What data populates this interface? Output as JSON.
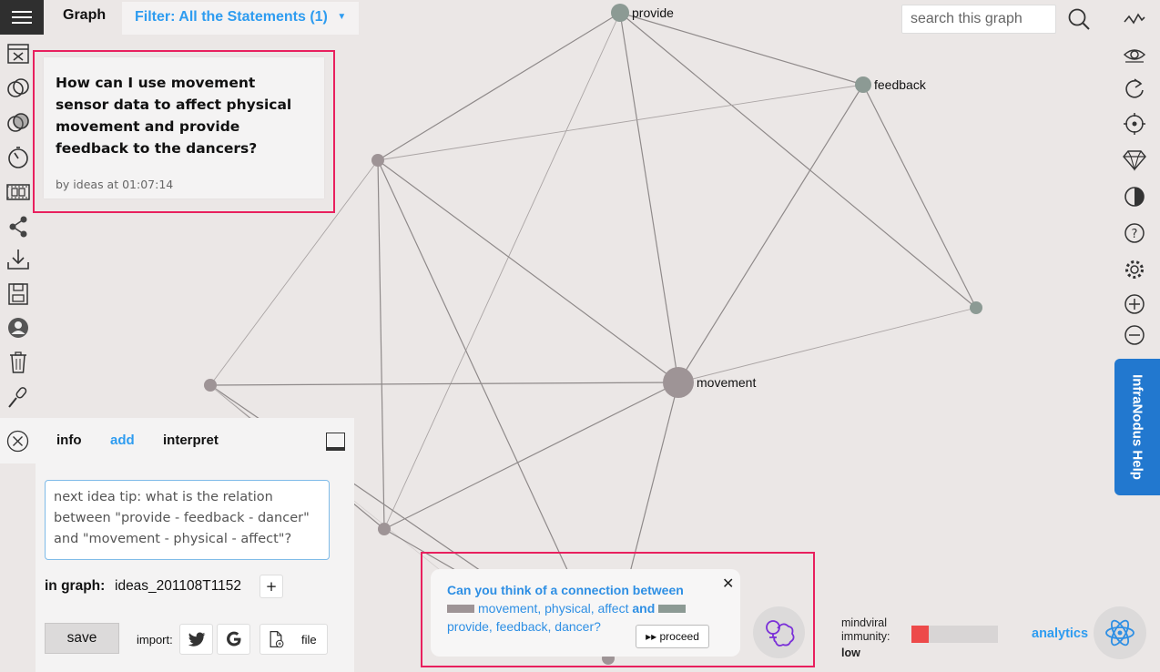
{
  "header": {
    "app_title": "Graph",
    "filter_label": "Filter: All the Statements (1)",
    "search_placeholder": "search this graph"
  },
  "graph": {
    "nodes": [
      {
        "id": "provide",
        "label": "provide",
        "color": "#8c9a94"
      },
      {
        "id": "feedback",
        "label": "feedback",
        "color": "#8c9a94"
      },
      {
        "id": "movement",
        "label": "movement",
        "color": "#9e9496"
      }
    ]
  },
  "statement": {
    "text": "How can I use movement sensor data to affect physical movement and provide feedback to the dancers?",
    "meta": "by ideas at 01:07:14"
  },
  "panel": {
    "tabs": [
      "info",
      "add",
      "interpret"
    ],
    "active_tab": "add",
    "idea_placeholder": "next idea tip: what is the relation between \"provide - feedback - dancer\" and \"movement - physical - affect\"?",
    "graph_label": "in graph:",
    "graph_name": "ideas_201108T1152",
    "save_label": "save",
    "import_label": "import:",
    "file_label": "file"
  },
  "help_tab": "InfraNodus Help",
  "suggestion": {
    "question": "Can you think of a connection between",
    "group1": "movement, physical, affect",
    "conjunction": "and",
    "group2": "provide, feedback, dancer?",
    "group1_color": "#9e9496",
    "group2_color": "#8c9a94",
    "proceed_label": "▸▸ proceed",
    "close": "✕"
  },
  "immunity": {
    "label": "mindviral immunity:",
    "value": "low",
    "level": 0.2,
    "color": "#ed4a4a"
  },
  "analytics_label": "analytics",
  "icons": {
    "left": [
      "dashboard-icon",
      "overlap-circles-icon",
      "venn-icon",
      "timer-icon",
      "film-icon",
      "share-icon",
      "download-icon",
      "save-disk-icon",
      "user-icon",
      "trash-icon",
      "microphone-icon"
    ],
    "right": [
      "wave-icon",
      "eye-icon",
      "refresh-icon",
      "target-icon",
      "diamond-icon",
      "contrast-icon",
      "help-icon",
      "settings-icon",
      "zoom-in-icon",
      "zoom-out-icon"
    ]
  }
}
